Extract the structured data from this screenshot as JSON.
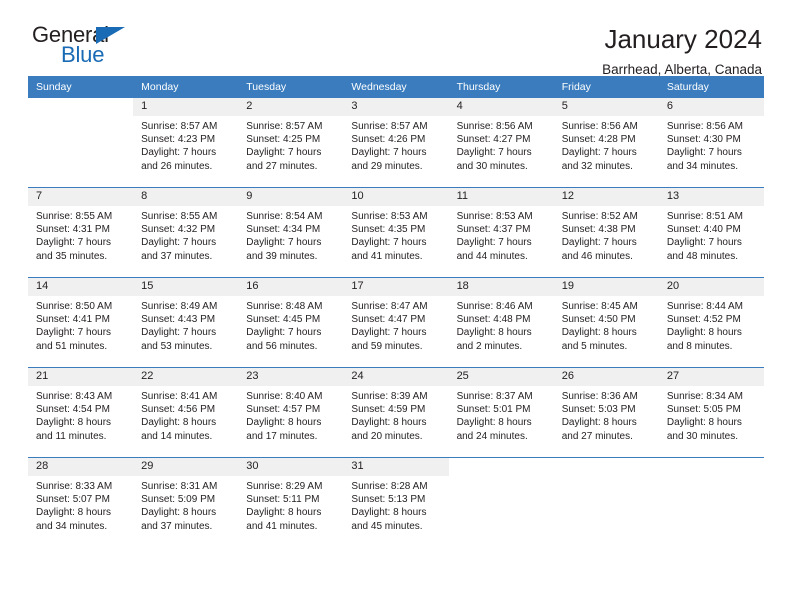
{
  "brand": {
    "name_part1": "General",
    "name_part2": "Blue",
    "triangle_color": "#1a6bb5",
    "accent_color": "#3a7cbe"
  },
  "header": {
    "title": "January 2024",
    "subtitle": "Barrhead, Alberta, Canada"
  },
  "calendar": {
    "weekday_headers": [
      "Sunday",
      "Monday",
      "Tuesday",
      "Wednesday",
      "Thursday",
      "Friday",
      "Saturday"
    ],
    "weeks": [
      [
        {
          "day": "",
          "sunrise": "",
          "sunset": "",
          "daylight1": "",
          "daylight2": ""
        },
        {
          "day": "1",
          "sunrise": "Sunrise: 8:57 AM",
          "sunset": "Sunset: 4:23 PM",
          "daylight1": "Daylight: 7 hours",
          "daylight2": "and 26 minutes."
        },
        {
          "day": "2",
          "sunrise": "Sunrise: 8:57 AM",
          "sunset": "Sunset: 4:25 PM",
          "daylight1": "Daylight: 7 hours",
          "daylight2": "and 27 minutes."
        },
        {
          "day": "3",
          "sunrise": "Sunrise: 8:57 AM",
          "sunset": "Sunset: 4:26 PM",
          "daylight1": "Daylight: 7 hours",
          "daylight2": "and 29 minutes."
        },
        {
          "day": "4",
          "sunrise": "Sunrise: 8:56 AM",
          "sunset": "Sunset: 4:27 PM",
          "daylight1": "Daylight: 7 hours",
          "daylight2": "and 30 minutes."
        },
        {
          "day": "5",
          "sunrise": "Sunrise: 8:56 AM",
          "sunset": "Sunset: 4:28 PM",
          "daylight1": "Daylight: 7 hours",
          "daylight2": "and 32 minutes."
        },
        {
          "day": "6",
          "sunrise": "Sunrise: 8:56 AM",
          "sunset": "Sunset: 4:30 PM",
          "daylight1": "Daylight: 7 hours",
          "daylight2": "and 34 minutes."
        }
      ],
      [
        {
          "day": "7",
          "sunrise": "Sunrise: 8:55 AM",
          "sunset": "Sunset: 4:31 PM",
          "daylight1": "Daylight: 7 hours",
          "daylight2": "and 35 minutes."
        },
        {
          "day": "8",
          "sunrise": "Sunrise: 8:55 AM",
          "sunset": "Sunset: 4:32 PM",
          "daylight1": "Daylight: 7 hours",
          "daylight2": "and 37 minutes."
        },
        {
          "day": "9",
          "sunrise": "Sunrise: 8:54 AM",
          "sunset": "Sunset: 4:34 PM",
          "daylight1": "Daylight: 7 hours",
          "daylight2": "and 39 minutes."
        },
        {
          "day": "10",
          "sunrise": "Sunrise: 8:53 AM",
          "sunset": "Sunset: 4:35 PM",
          "daylight1": "Daylight: 7 hours",
          "daylight2": "and 41 minutes."
        },
        {
          "day": "11",
          "sunrise": "Sunrise: 8:53 AM",
          "sunset": "Sunset: 4:37 PM",
          "daylight1": "Daylight: 7 hours",
          "daylight2": "and 44 minutes."
        },
        {
          "day": "12",
          "sunrise": "Sunrise: 8:52 AM",
          "sunset": "Sunset: 4:38 PM",
          "daylight1": "Daylight: 7 hours",
          "daylight2": "and 46 minutes."
        },
        {
          "day": "13",
          "sunrise": "Sunrise: 8:51 AM",
          "sunset": "Sunset: 4:40 PM",
          "daylight1": "Daylight: 7 hours",
          "daylight2": "and 48 minutes."
        }
      ],
      [
        {
          "day": "14",
          "sunrise": "Sunrise: 8:50 AM",
          "sunset": "Sunset: 4:41 PM",
          "daylight1": "Daylight: 7 hours",
          "daylight2": "and 51 minutes."
        },
        {
          "day": "15",
          "sunrise": "Sunrise: 8:49 AM",
          "sunset": "Sunset: 4:43 PM",
          "daylight1": "Daylight: 7 hours",
          "daylight2": "and 53 minutes."
        },
        {
          "day": "16",
          "sunrise": "Sunrise: 8:48 AM",
          "sunset": "Sunset: 4:45 PM",
          "daylight1": "Daylight: 7 hours",
          "daylight2": "and 56 minutes."
        },
        {
          "day": "17",
          "sunrise": "Sunrise: 8:47 AM",
          "sunset": "Sunset: 4:47 PM",
          "daylight1": "Daylight: 7 hours",
          "daylight2": "and 59 minutes."
        },
        {
          "day": "18",
          "sunrise": "Sunrise: 8:46 AM",
          "sunset": "Sunset: 4:48 PM",
          "daylight1": "Daylight: 8 hours",
          "daylight2": "and 2 minutes."
        },
        {
          "day": "19",
          "sunrise": "Sunrise: 8:45 AM",
          "sunset": "Sunset: 4:50 PM",
          "daylight1": "Daylight: 8 hours",
          "daylight2": "and 5 minutes."
        },
        {
          "day": "20",
          "sunrise": "Sunrise: 8:44 AM",
          "sunset": "Sunset: 4:52 PM",
          "daylight1": "Daylight: 8 hours",
          "daylight2": "and 8 minutes."
        }
      ],
      [
        {
          "day": "21",
          "sunrise": "Sunrise: 8:43 AM",
          "sunset": "Sunset: 4:54 PM",
          "daylight1": "Daylight: 8 hours",
          "daylight2": "and 11 minutes."
        },
        {
          "day": "22",
          "sunrise": "Sunrise: 8:41 AM",
          "sunset": "Sunset: 4:56 PM",
          "daylight1": "Daylight: 8 hours",
          "daylight2": "and 14 minutes."
        },
        {
          "day": "23",
          "sunrise": "Sunrise: 8:40 AM",
          "sunset": "Sunset: 4:57 PM",
          "daylight1": "Daylight: 8 hours",
          "daylight2": "and 17 minutes."
        },
        {
          "day": "24",
          "sunrise": "Sunrise: 8:39 AM",
          "sunset": "Sunset: 4:59 PM",
          "daylight1": "Daylight: 8 hours",
          "daylight2": "and 20 minutes."
        },
        {
          "day": "25",
          "sunrise": "Sunrise: 8:37 AM",
          "sunset": "Sunset: 5:01 PM",
          "daylight1": "Daylight: 8 hours",
          "daylight2": "and 24 minutes."
        },
        {
          "day": "26",
          "sunrise": "Sunrise: 8:36 AM",
          "sunset": "Sunset: 5:03 PM",
          "daylight1": "Daylight: 8 hours",
          "daylight2": "and 27 minutes."
        },
        {
          "day": "27",
          "sunrise": "Sunrise: 8:34 AM",
          "sunset": "Sunset: 5:05 PM",
          "daylight1": "Daylight: 8 hours",
          "daylight2": "and 30 minutes."
        }
      ],
      [
        {
          "day": "28",
          "sunrise": "Sunrise: 8:33 AM",
          "sunset": "Sunset: 5:07 PM",
          "daylight1": "Daylight: 8 hours",
          "daylight2": "and 34 minutes."
        },
        {
          "day": "29",
          "sunrise": "Sunrise: 8:31 AM",
          "sunset": "Sunset: 5:09 PM",
          "daylight1": "Daylight: 8 hours",
          "daylight2": "and 37 minutes."
        },
        {
          "day": "30",
          "sunrise": "Sunrise: 8:29 AM",
          "sunset": "Sunset: 5:11 PM",
          "daylight1": "Daylight: 8 hours",
          "daylight2": "and 41 minutes."
        },
        {
          "day": "31",
          "sunrise": "Sunrise: 8:28 AM",
          "sunset": "Sunset: 5:13 PM",
          "daylight1": "Daylight: 8 hours",
          "daylight2": "and 45 minutes."
        },
        {
          "day": "",
          "sunrise": "",
          "sunset": "",
          "daylight1": "",
          "daylight2": ""
        },
        {
          "day": "",
          "sunrise": "",
          "sunset": "",
          "daylight1": "",
          "daylight2": ""
        },
        {
          "day": "",
          "sunrise": "",
          "sunset": "",
          "daylight1": "",
          "daylight2": ""
        }
      ]
    ]
  }
}
